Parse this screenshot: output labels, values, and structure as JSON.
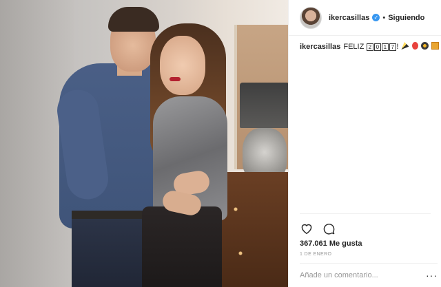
{
  "photo": {
    "alt": ""
  },
  "header": {
    "username": "ikercasillas",
    "verified": "✓",
    "separator": "•",
    "follow_status": "Siguiendo"
  },
  "caption": {
    "username": "ikercasillas",
    "text": "FELIZ",
    "boxed_digits": [
      "2",
      "0",
      "1",
      "7"
    ],
    "after": "!",
    "emojis": [
      "party-popper",
      "balloon",
      "sparkler",
      "gift"
    ]
  },
  "actions": {
    "like_icon": "heart-icon",
    "comment_icon": "comment-icon"
  },
  "likes": "367.061 Me gusta",
  "date": "1 DE ENERO",
  "comment": {
    "placeholder": "Añade un comentario...",
    "more": "···"
  },
  "colors": {
    "verified": "#3897f0",
    "text": "#262626",
    "muted": "#999999",
    "border": "#efefef"
  }
}
